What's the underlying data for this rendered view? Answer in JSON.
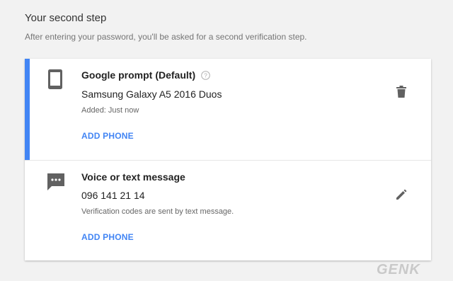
{
  "section": {
    "title": "Your second step",
    "description": "After entering your password, you'll be asked for a second verification step."
  },
  "options": [
    {
      "title": "Google prompt",
      "title_suffix": "(Default)",
      "device": "Samsung Galaxy A5 2016 Duos",
      "added": "Added: Just now",
      "add_phone": "ADD PHONE",
      "icon": "smartphone-icon",
      "action_icon": "delete-icon"
    },
    {
      "title": "Voice or text message",
      "number": "096 141 21 14",
      "description": "Verification codes are sent by text message.",
      "add_phone": "ADD PHONE",
      "icon": "sms-icon",
      "action_icon": "edit-icon"
    }
  ],
  "watermark": "GENK",
  "colors": {
    "accent": "#4285f4",
    "background": "#f2f2f2",
    "card": "#ffffff",
    "icon": "#616161"
  }
}
